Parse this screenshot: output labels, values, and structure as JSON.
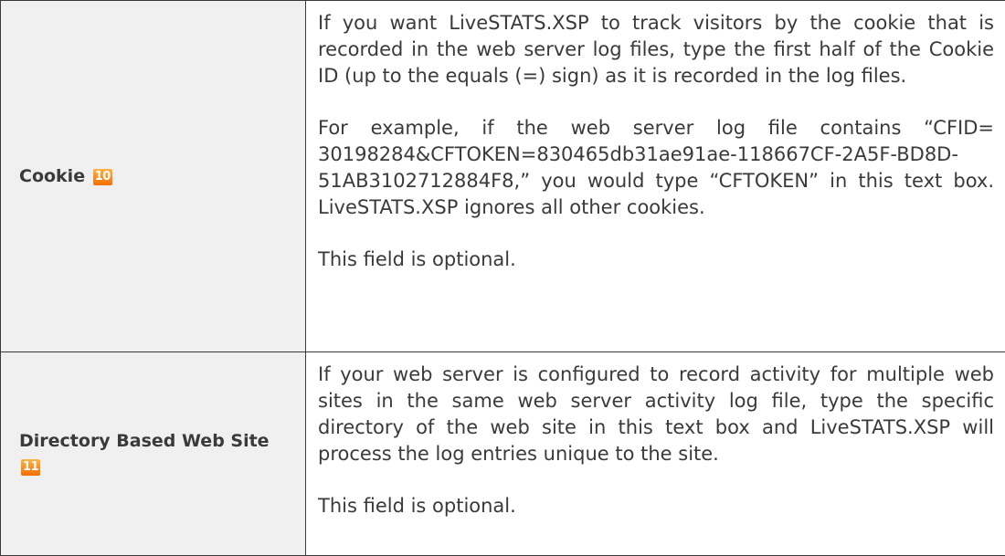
{
  "rows": [
    {
      "label": "Cookie",
      "badge": "10",
      "paragraphs": [
        "If you want LiveSTATS.XSP to track visitors by the cookie that is recorded in the web server log files, type the first half of the Cookie ID (up to the equals (=) sign) as it is recorded in the log files.",
        "For example, if the web server log file contains “CFID= 30198284&CFTOKEN=830465db31ae91ae-118667CF-2A5F-BD8D-51AB3102712884F8,” you would type “CFTOKEN” in this text box. LiveSTATS.XSP ignores all other cookies.",
        "This field is optional."
      ]
    },
    {
      "label": "Directory Based Web Site",
      "badge": "11",
      "paragraphs": [
        "If your web server is configured to record activity for multiple web sites in the same web server activity log file, type the specific directory of the web site in this text box and LiveSTATS.XSP will process the log entries unique to the site.",
        "This field is optional."
      ]
    }
  ],
  "colors": {
    "border": "#3a3a3a",
    "label_bg": "#f0f0f0",
    "text": "#3a3a3a",
    "badge": "#f36f00"
  }
}
